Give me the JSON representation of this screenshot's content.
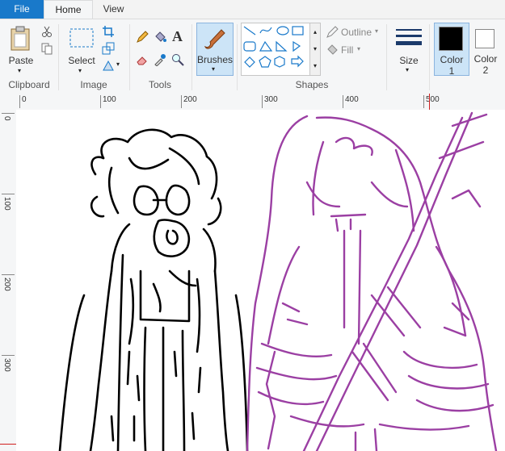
{
  "tabs": {
    "file": "File",
    "home": "Home",
    "view": "View"
  },
  "clipboard": {
    "paste": "Paste",
    "group": "Clipboard"
  },
  "image": {
    "select": "Select",
    "group": "Image"
  },
  "tools": {
    "group": "Tools"
  },
  "brushes": {
    "label": "Brushes"
  },
  "shapes": {
    "outline": "Outline",
    "fill": "Fill",
    "group": "Shapes"
  },
  "size": {
    "label": "Size"
  },
  "color1": {
    "label": "Color",
    "number": "1",
    "value": "#000000"
  },
  "color2": {
    "label": "Color",
    "number": "2",
    "value": "#ffffff"
  },
  "ruler": {
    "h_labels": [
      "0",
      "100",
      "200",
      "300",
      "400",
      "500"
    ],
    "v_labels": [
      "0",
      "100",
      "200",
      "300"
    ]
  },
  "colors": {
    "accent": "#1979ca",
    "sketch_left": "#000000",
    "sketch_right": "#9b3fa3"
  }
}
